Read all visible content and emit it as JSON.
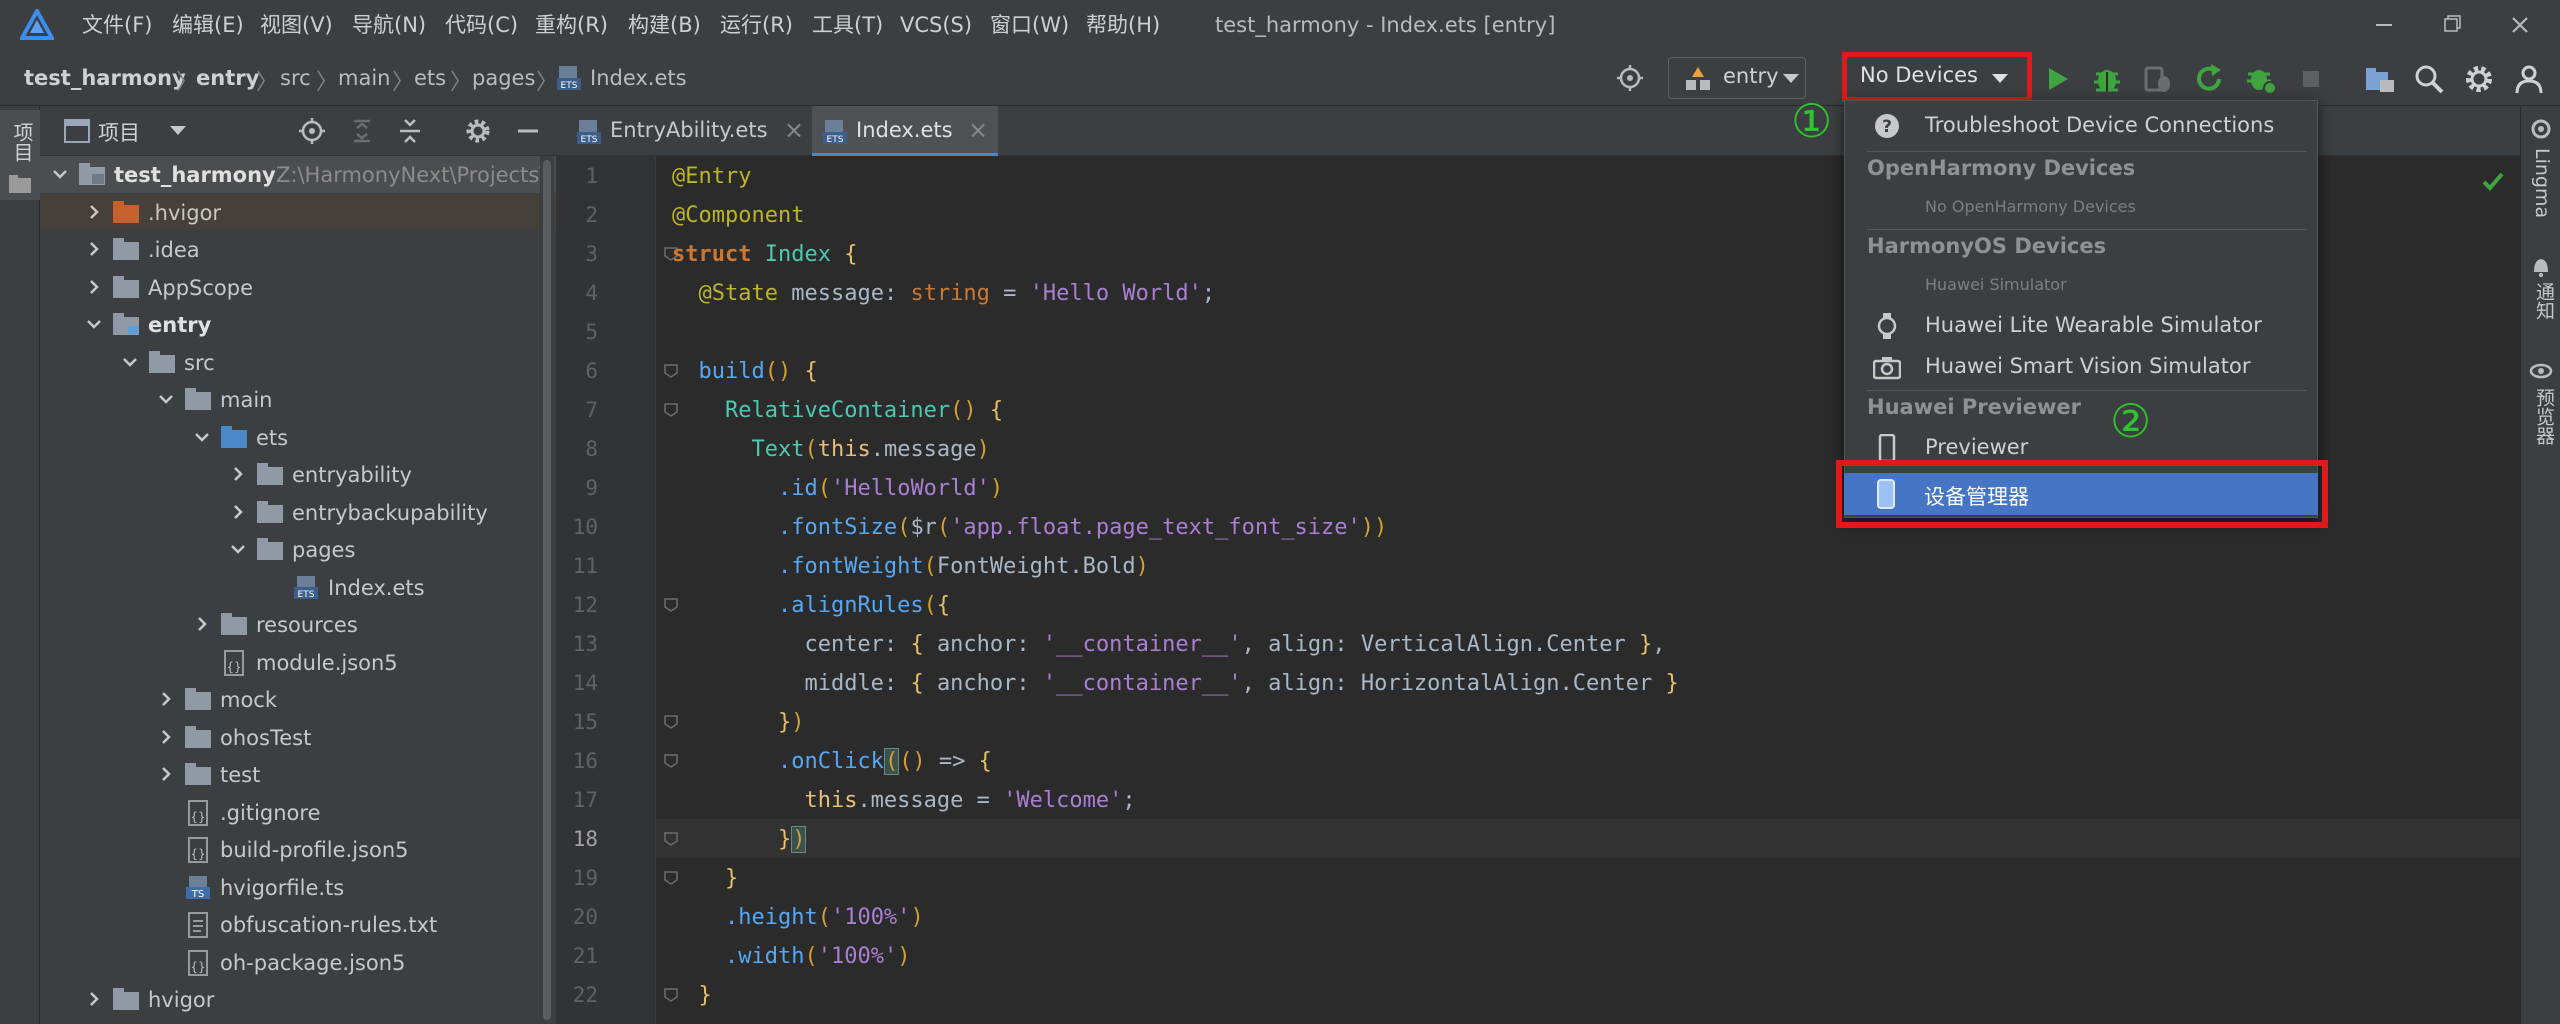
{
  "titlebar": {
    "menus": [
      "文件(F)",
      "编辑(E)",
      "视图(V)",
      "导航(N)",
      "代码(C)",
      "重构(R)",
      "构建(B)",
      "运行(R)",
      "工具(T)",
      "VCS(S)",
      "窗口(W)",
      "帮助(H)"
    ],
    "window_title": "test_harmony - Index.ets [entry]"
  },
  "navbar": {
    "breadcrumbs": [
      "test_harmony",
      "entry",
      "src",
      "main",
      "ets",
      "pages",
      "Index.ets"
    ],
    "run_config": "entry",
    "device_selector": "No Devices"
  },
  "annotations": {
    "step1": "①",
    "step2": "②"
  },
  "left_strip": {
    "project_tab": "项目"
  },
  "project_panel": {
    "title": "项目",
    "tree": [
      {
        "label": "test_harmony",
        "path": "Z:\\HarmonyNext\\Projects\\te",
        "bold": true
      },
      {
        "label": ".hvigor"
      },
      {
        "label": ".idea"
      },
      {
        "label": "AppScope"
      },
      {
        "label": "entry",
        "bold": true
      },
      {
        "label": "src"
      },
      {
        "label": "main"
      },
      {
        "label": "ets"
      },
      {
        "label": "entryability"
      },
      {
        "label": "entrybackupability"
      },
      {
        "label": "pages"
      },
      {
        "label": "Index.ets"
      },
      {
        "label": "resources"
      },
      {
        "label": "module.json5"
      },
      {
        "label": "mock"
      },
      {
        "label": "ohosTest"
      },
      {
        "label": "test"
      },
      {
        "label": ".gitignore"
      },
      {
        "label": "build-profile.json5"
      },
      {
        "label": "hvigorfile.ts"
      },
      {
        "label": "obfuscation-rules.txt"
      },
      {
        "label": "oh-package.json5"
      },
      {
        "label": "hvigor"
      }
    ]
  },
  "editor": {
    "tabs": [
      "EntryAbility.ets",
      "Index.ets"
    ],
    "active_tab": "Index.ets",
    "current_line": 18,
    "line_numbers": [
      "1",
      "2",
      "3",
      "4",
      "5",
      "6",
      "7",
      "8",
      "9",
      "10",
      "11",
      "12",
      "13",
      "14",
      "15",
      "16",
      "17",
      "18",
      "19",
      "20",
      "21",
      "22"
    ],
    "code": {
      "l1": "@Entry",
      "l2": "@Component",
      "l3_kw": "struct",
      "l3_name": "Index",
      "l4_dec": "@State",
      "l4_var": "message",
      "l4_type": "string",
      "l4_val": "'Hello World'",
      "l6": "build",
      "l7": "RelativeContainer",
      "l8_fn": "Text",
      "l8_this": "this",
      "l8_prop": ".message",
      "l9_fn": ".id",
      "l9_arg": "'HelloWorld'",
      "l10_fn": ".fontSize",
      "l10_r": "$r",
      "l10_arg": "'app.float.page_text_font_size'",
      "l11_fn": ".fontWeight",
      "l11_arg": "FontWeight.Bold",
      "l12_fn": ".alignRules",
      "l13_key": "center",
      "l13_anchor": "anchor",
      "l13_str": "'__container__'",
      "l13_align": "align",
      "l13_val": "VerticalAlign.Center",
      "l14_key": "middle",
      "l14_anchor": "anchor",
      "l14_str": "'__container__'",
      "l14_align": "align",
      "l14_val": "HorizontalAlign.Center",
      "l16_fn": ".onClick",
      "l17_this": "this",
      "l17_prop": ".message",
      "l17_val": "'Welcome'",
      "l20_fn": ".height",
      "l20_arg": "'100%'",
      "l21_fn": ".width",
      "l21_arg": "'100%'"
    }
  },
  "right_strip": {
    "labels": [
      "Lingma",
      "通知",
      "预览器"
    ]
  },
  "device_dropdown": {
    "troubleshoot": "Troubleshoot Device Connections",
    "openharmony_header": "OpenHarmony Devices",
    "openharmony_empty": "No OpenHarmony Devices",
    "harmonyos_header": "HarmonyOS Devices",
    "huawei_simulator": "Huawei Simulator",
    "lite_wearable": "Huawei Lite Wearable Simulator",
    "smart_vision": "Huawei Smart Vision Simulator",
    "previewer_header": "Huawei Previewer",
    "previewer": "Previewer",
    "device_manager": "设备管理器"
  },
  "colors": {
    "accent_blue": "#4575c4",
    "highlight_red": "#e01a1a",
    "annotation_green": "#2ec52e",
    "run_green": "#3fa53f"
  }
}
